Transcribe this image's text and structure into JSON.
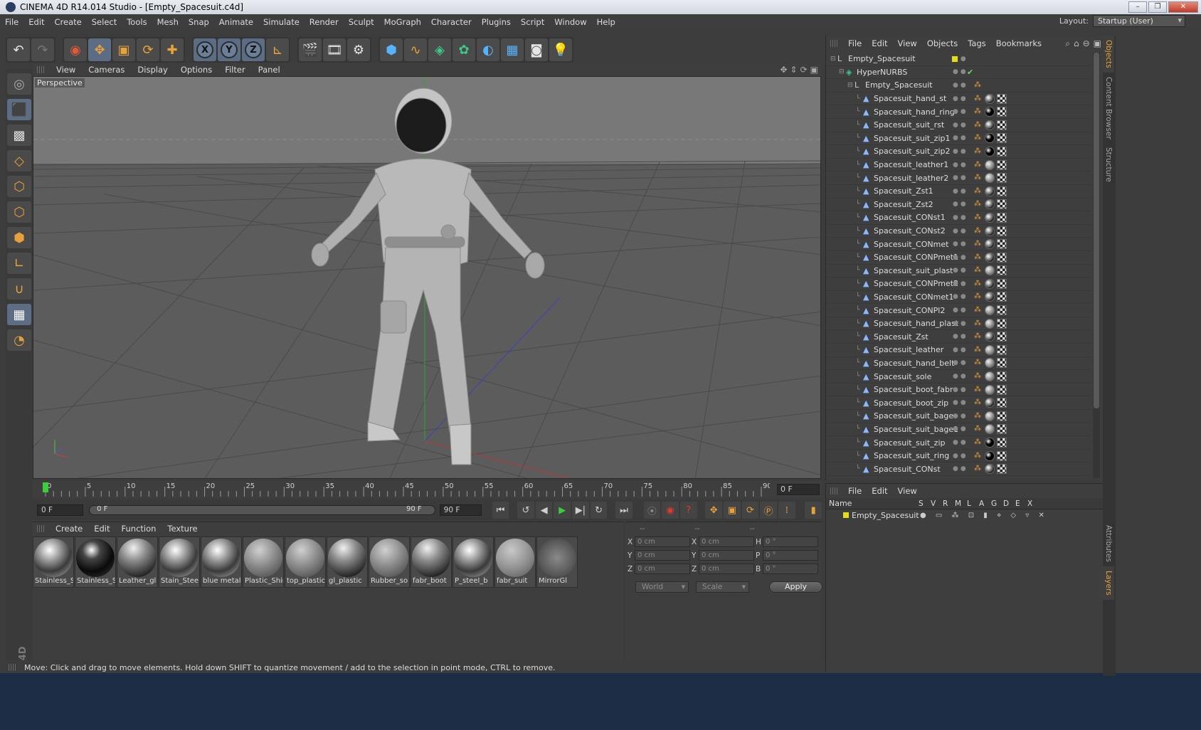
{
  "window": {
    "title": "CINEMA 4D R14.014 Studio - [Empty_Spacesuit.c4d]"
  },
  "menubar": {
    "items": [
      "File",
      "Edit",
      "Create",
      "Select",
      "Tools",
      "Mesh",
      "Snap",
      "Animate",
      "Simulate",
      "Render",
      "Sculpt",
      "MoGraph",
      "Character",
      "Plugins",
      "Script",
      "Window",
      "Help"
    ],
    "layout_label": "Layout:",
    "layout_value": "Startup (User)"
  },
  "viewport": {
    "menu": [
      "View",
      "Cameras",
      "Display",
      "Options",
      "Filter",
      "Panel"
    ],
    "camera_label": "Perspective"
  },
  "timeline": {
    "ticks": [
      "0",
      "5",
      "10",
      "15",
      "20",
      "25",
      "30",
      "35",
      "40",
      "45",
      "50",
      "55",
      "60",
      "65",
      "70",
      "75",
      "80",
      "85",
      "90"
    ],
    "current_frame": "0 F",
    "start_field": "0 F",
    "range_start": "0 F",
    "range_end": "90 F",
    "end_field": "90 F"
  },
  "material_manager": {
    "menu": [
      "Create",
      "Edit",
      "Function",
      "Texture"
    ],
    "materials": [
      {
        "label": "Stainless_S",
        "style": "chrome"
      },
      {
        "label": "Stainless_S",
        "style": "dark"
      },
      {
        "label": "Leather_gl",
        "style": "glossy"
      },
      {
        "label": "Stain_Steel",
        "style": "chrome"
      },
      {
        "label": "blue metal",
        "style": "chrome"
      },
      {
        "label": "Plastic_Shir",
        "style": "grey"
      },
      {
        "label": "top_plastic",
        "style": "grey"
      },
      {
        "label": "gl_plastic",
        "style": "glossy"
      },
      {
        "label": "Rubber_so",
        "style": "grey"
      },
      {
        "label": "fabr_boot",
        "style": "glossy"
      },
      {
        "label": "P_steel_b",
        "style": "chrome"
      },
      {
        "label": "fabr_suit",
        "style": "fabric"
      },
      {
        "label": "MirrorGl",
        "style": "mirror"
      }
    ]
  },
  "coordinates": {
    "header": [
      "--",
      "--",
      "--"
    ],
    "rows": [
      {
        "a1": "X",
        "v1": "0 cm",
        "a2": "X",
        "v2": "0 cm",
        "a3": "H",
        "v3": "0 °"
      },
      {
        "a1": "Y",
        "v1": "0 cm",
        "a2": "Y",
        "v2": "0 cm",
        "a3": "P",
        "v3": "0 °"
      },
      {
        "a1": "Z",
        "v1": "0 cm",
        "a2": "Z",
        "v2": "0 cm",
        "a3": "B",
        "v3": "0 °"
      }
    ],
    "mode1": "World",
    "mode2": "Scale",
    "apply_label": "Apply"
  },
  "status": {
    "message": "Move: Click and drag to move elements. Hold down SHIFT to quantize movement / add to the selection in point mode, CTRL to remove."
  },
  "object_manager": {
    "menu": [
      "File",
      "Edit",
      "View",
      "Objects",
      "Tags",
      "Bookmarks"
    ],
    "objects": [
      {
        "name": "Empty_Spacesuit",
        "depth": 0,
        "kind": "null"
      },
      {
        "name": "HyperNURBS",
        "depth": 1,
        "kind": "nurbs"
      },
      {
        "name": "Empty_Spacesuit",
        "depth": 2,
        "kind": "null"
      },
      {
        "name": "Spacesuit_hand_st",
        "depth": 3,
        "kind": "poly",
        "mat": "dark"
      },
      {
        "name": "Spacesuit_hand_ring",
        "depth": 3,
        "kind": "poly",
        "mat": "black"
      },
      {
        "name": "Spacesuit_suit_rst",
        "depth": 3,
        "kind": "poly",
        "mat": "dark"
      },
      {
        "name": "Spacesuit_suit_zip1",
        "depth": 3,
        "kind": "poly",
        "mat": "black"
      },
      {
        "name": "Spacesuit_suit_zip2",
        "depth": 3,
        "kind": "poly",
        "mat": "black"
      },
      {
        "name": "Spacesuit_leather1",
        "depth": 3,
        "kind": "poly",
        "mat": "grey"
      },
      {
        "name": "Spacesuit_leather2",
        "depth": 3,
        "kind": "poly",
        "mat": "grey"
      },
      {
        "name": "Spacesuit_Zst1",
        "depth": 3,
        "kind": "poly",
        "mat": "dark"
      },
      {
        "name": "Spacesuit_Zst2",
        "depth": 3,
        "kind": "poly",
        "mat": "dark"
      },
      {
        "name": "Spacesuit_CONst1",
        "depth": 3,
        "kind": "poly",
        "mat": "dark"
      },
      {
        "name": "Spacesuit_CONst2",
        "depth": 3,
        "kind": "poly",
        "mat": "dark"
      },
      {
        "name": "Spacesuit_CONmet",
        "depth": 3,
        "kind": "poly",
        "mat": "dark"
      },
      {
        "name": "Spacesuit_CONPmet1",
        "depth": 3,
        "kind": "poly",
        "mat": "dark"
      },
      {
        "name": "Spacesuit_suit_plast",
        "depth": 3,
        "kind": "poly",
        "mat": "grey"
      },
      {
        "name": "Spacesuit_CONPmet2",
        "depth": 3,
        "kind": "poly",
        "mat": "dark"
      },
      {
        "name": "Spacesuit_CONmet1",
        "depth": 3,
        "kind": "poly",
        "mat": "dark"
      },
      {
        "name": "Spacesuit_CONPl2",
        "depth": 3,
        "kind": "poly",
        "mat": "grey"
      },
      {
        "name": "Spacesuit_hand_plast",
        "depth": 3,
        "kind": "poly",
        "mat": "grey"
      },
      {
        "name": "Spacesuit_Zst",
        "depth": 3,
        "kind": "poly",
        "mat": "dark"
      },
      {
        "name": "Spacesuit_leather",
        "depth": 3,
        "kind": "poly",
        "mat": "grey"
      },
      {
        "name": "Spacesuit_hand_belt",
        "depth": 3,
        "kind": "poly",
        "mat": "grey"
      },
      {
        "name": "Spacesuit_sole",
        "depth": 3,
        "kind": "poly",
        "mat": "grey"
      },
      {
        "name": "Spacesuit_boot_fabr",
        "depth": 3,
        "kind": "poly",
        "mat": "grey"
      },
      {
        "name": "Spacesuit_boot_zip",
        "depth": 3,
        "kind": "poly",
        "mat": "dark"
      },
      {
        "name": "Spacesuit_suit_bage",
        "depth": 3,
        "kind": "poly",
        "mat": "grey"
      },
      {
        "name": "Spacesuit_suit_bage1",
        "depth": 3,
        "kind": "poly",
        "mat": "grey"
      },
      {
        "name": "Spacesuit_suit_zip",
        "depth": 3,
        "kind": "poly",
        "mat": "black"
      },
      {
        "name": "Spacesuit_suit_ring",
        "depth": 3,
        "kind": "poly",
        "mat": "black"
      },
      {
        "name": "Spacesuit_CONst",
        "depth": 3,
        "kind": "poly",
        "mat": "dark"
      }
    ]
  },
  "layer_manager": {
    "menu": [
      "File",
      "Edit",
      "View"
    ],
    "columns_name": "Name",
    "columns": [
      "S",
      "V",
      "R",
      "M",
      "L",
      "A",
      "G",
      "D",
      "E",
      "X"
    ],
    "row_name": "Empty_Spacesuit"
  },
  "right_tabs": [
    "Objects",
    "Content Browser",
    "Structure",
    "Attributes",
    "Layers"
  ],
  "branding": "MAXON CINEMA 4D",
  "colors": {
    "accent_orange": "#e8a23a",
    "selection_blue": "#5b6c84",
    "play_green": "#3ecb3e"
  }
}
